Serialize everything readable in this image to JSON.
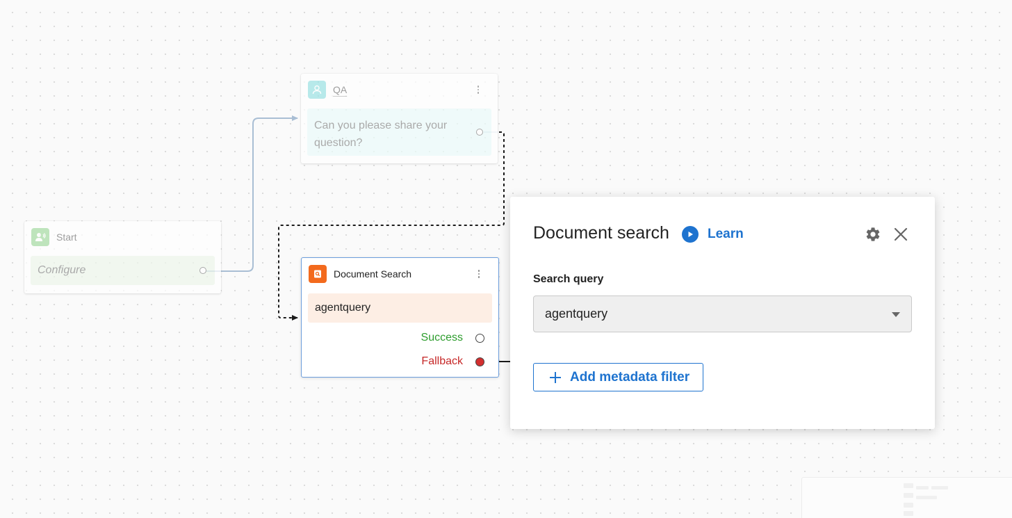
{
  "canvas": {
    "background": "#fafafa",
    "connector_color": "#a9bed4",
    "dashed_connector_color": "#1a1a1a"
  },
  "nodes": {
    "start": {
      "title": "Start",
      "body": "Configure",
      "icon": "start-person-speaking-icon",
      "accent": "#a8dca5"
    },
    "qa": {
      "title": "QA",
      "body": "Can you please share your question?",
      "icon": "user-icon",
      "accent": "#9ee3e5"
    },
    "document_search": {
      "title": "Document Search",
      "body": "agentquery",
      "icon": "document-search-icon",
      "accent": "#f36a1d",
      "outcomes": {
        "success": "Success",
        "success_color": "#2e9d2e",
        "fallback": "Fallback",
        "fallback_color": "#c62828"
      }
    }
  },
  "panel": {
    "title": "Document search",
    "learn_label": "Learn",
    "search_query_label": "Search query",
    "search_query_value": "agentquery",
    "add_filter_label": "Add metadata filter",
    "accent": "#1e73cf"
  }
}
